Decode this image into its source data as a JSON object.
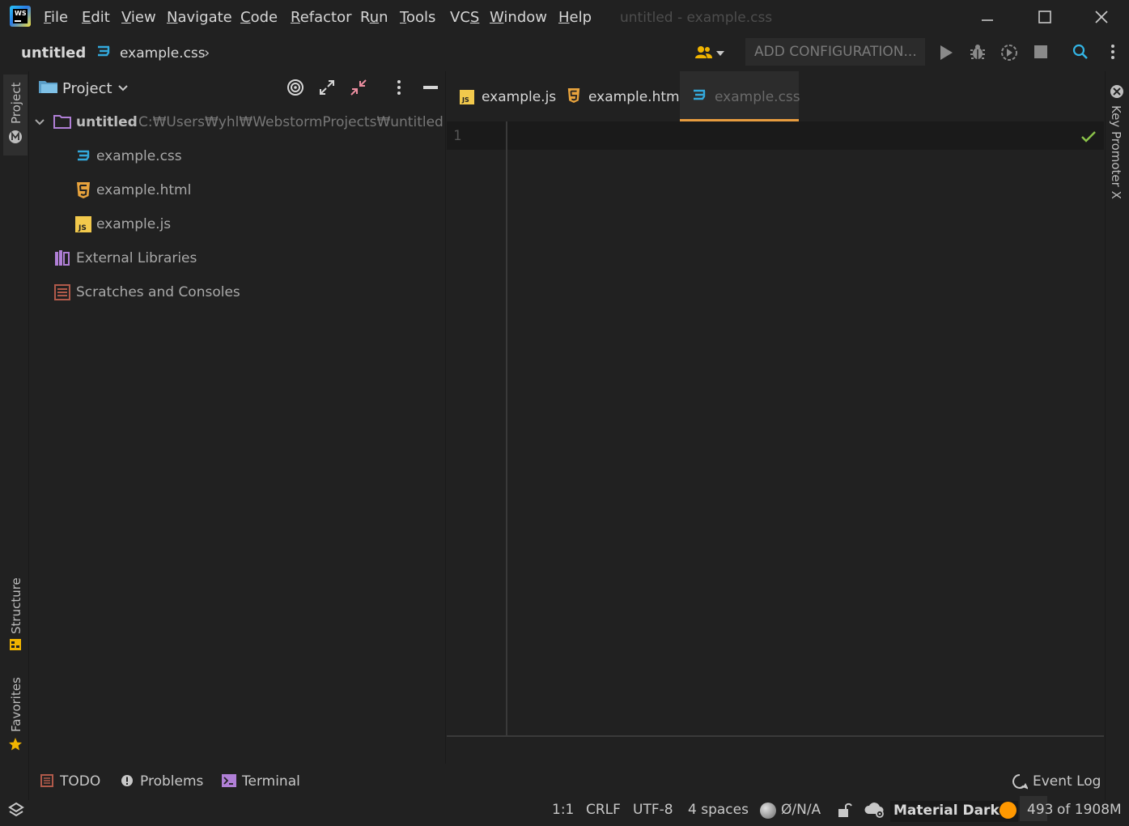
{
  "menu": {
    "items": [
      {
        "underline": "F",
        "rest": "ile"
      },
      {
        "underline": "E",
        "rest": "dit"
      },
      {
        "underline": "V",
        "rest": "iew"
      },
      {
        "underline": "N",
        "rest": "avigate"
      },
      {
        "underline": "C",
        "rest": "ode"
      },
      {
        "underline": "R",
        "rest": "efactor"
      },
      {
        "pre": "R",
        "underline": "u",
        "rest": "n"
      },
      {
        "underline": "T",
        "rest": "ools"
      },
      {
        "pre": "VC",
        "underline": "S",
        "rest": ""
      },
      {
        "underline": "W",
        "rest": "indow"
      },
      {
        "underline": "H",
        "rest": "elp"
      }
    ]
  },
  "window": {
    "title": "untitled - example.css"
  },
  "breadcrumb": {
    "project": "untitled",
    "file": "example.css"
  },
  "toolbar": {
    "config_label": "ADD CONFIGURATION..."
  },
  "left_strip": {
    "project": "Project",
    "structure": "Structure",
    "favorites": "Favorites"
  },
  "right_strip": {
    "key_promoter": "Key Promoter X"
  },
  "project_panel": {
    "title": "Project",
    "root": {
      "name": "untitled",
      "path": "C:₩Users₩yhl₩WebstormProjects₩untitled"
    },
    "files": [
      "example.css",
      "example.html",
      "example.js"
    ],
    "external_libraries": "External Libraries",
    "scratches": "Scratches and Consoles"
  },
  "editor": {
    "tabs": [
      "example.js",
      "example.html",
      "example.css"
    ],
    "active_tab": "example.css",
    "line_number": "1"
  },
  "bottom_tools": {
    "todo": "TODO",
    "problems": "Problems",
    "terminal": "Terminal",
    "event_log": "Event Log"
  },
  "status_bar": {
    "position": "1:1",
    "line_sep": "CRLF",
    "encoding": "UTF-8",
    "indent": "4 spaces",
    "vcs": "Ø/N/A",
    "theme": "Material Darker",
    "memory_used": "493",
    "memory_of": "of 1908M"
  },
  "colors": {
    "accent": "#e79c3f",
    "css_icon": "#33a9dc",
    "html_icon": "#e8a33d",
    "js_icon": "#f2c94c",
    "folder": "#b07fd6",
    "check": "#8bc34a"
  }
}
